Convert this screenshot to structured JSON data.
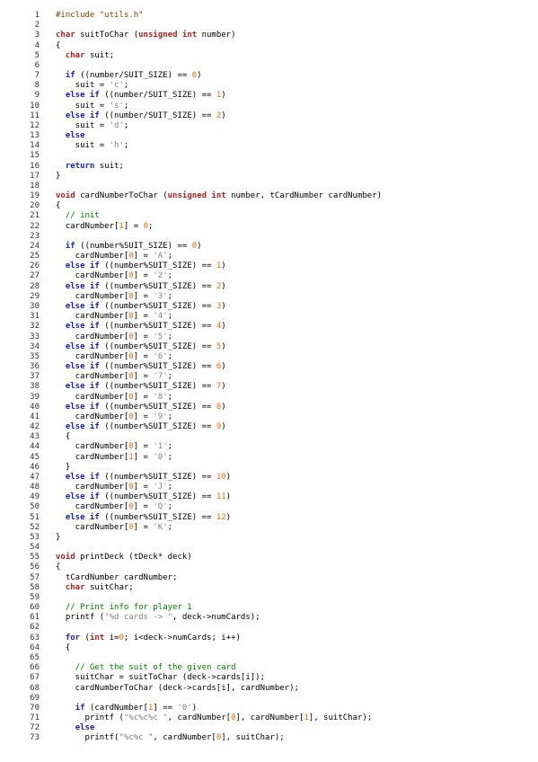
{
  "colors": {
    "keyword": "#1c1cd0",
    "type": "#b02020",
    "number": "#ff6600",
    "string": "#808080",
    "comment": "#008000",
    "preprocessor": "#804000"
  },
  "lines": [
    {
      "n": "1",
      "tokens": [
        [
          "pp",
          "#include \"utils.h\""
        ]
      ]
    },
    {
      "n": "2",
      "tokens": []
    },
    {
      "n": "3",
      "tokens": [
        [
          "ty",
          "char"
        ],
        [
          "",
          " suitToChar ("
        ],
        [
          "ty",
          "unsigned int"
        ],
        [
          "",
          " number)"
        ]
      ]
    },
    {
      "n": "4",
      "tokens": [
        [
          "",
          "{"
        ]
      ]
    },
    {
      "n": "5",
      "tokens": [
        [
          "",
          "  "
        ],
        [
          "ty",
          "char"
        ],
        [
          "",
          " suit;"
        ]
      ]
    },
    {
      "n": "6",
      "tokens": []
    },
    {
      "n": "7",
      "tokens": [
        [
          "",
          "  "
        ],
        [
          "kw",
          "if"
        ],
        [
          "",
          " ((number/SUIT_SIZE) == "
        ],
        [
          "num",
          "0"
        ],
        [
          "",
          ")"
        ]
      ]
    },
    {
      "n": "8",
      "tokens": [
        [
          "",
          "    suit = "
        ],
        [
          "str",
          "'c'"
        ],
        [
          "",
          ";"
        ]
      ]
    },
    {
      "n": "9",
      "tokens": [
        [
          "",
          "  "
        ],
        [
          "kw",
          "else if"
        ],
        [
          "",
          " ((number/SUIT_SIZE) == "
        ],
        [
          "num",
          "1"
        ],
        [
          "",
          ")"
        ]
      ]
    },
    {
      "n": "10",
      "tokens": [
        [
          "",
          "    suit = "
        ],
        [
          "str",
          "'s'"
        ],
        [
          "",
          ";"
        ]
      ]
    },
    {
      "n": "11",
      "tokens": [
        [
          "",
          "  "
        ],
        [
          "kw",
          "else if"
        ],
        [
          "",
          " ((number/SUIT_SIZE) == "
        ],
        [
          "num",
          "2"
        ],
        [
          "",
          ")"
        ]
      ]
    },
    {
      "n": "12",
      "tokens": [
        [
          "",
          "    suit = "
        ],
        [
          "str",
          "'d'"
        ],
        [
          "",
          ";"
        ]
      ]
    },
    {
      "n": "13",
      "tokens": [
        [
          "",
          "  "
        ],
        [
          "kw",
          "else"
        ]
      ]
    },
    {
      "n": "14",
      "tokens": [
        [
          "",
          "    suit = "
        ],
        [
          "str",
          "'h'"
        ],
        [
          "",
          ";"
        ]
      ]
    },
    {
      "n": "15",
      "tokens": []
    },
    {
      "n": "16",
      "tokens": [
        [
          "",
          "  "
        ],
        [
          "kw",
          "return"
        ],
        [
          "",
          " suit;"
        ]
      ]
    },
    {
      "n": "17",
      "tokens": [
        [
          "",
          "}"
        ]
      ]
    },
    {
      "n": "18",
      "tokens": []
    },
    {
      "n": "19",
      "tokens": [
        [
          "ty",
          "void"
        ],
        [
          "",
          " cardNumberToChar ("
        ],
        [
          "ty",
          "unsigned int"
        ],
        [
          "",
          " number, tCardNumber cardNumber)"
        ]
      ]
    },
    {
      "n": "20",
      "tokens": [
        [
          "",
          "{"
        ]
      ]
    },
    {
      "n": "21",
      "tokens": [
        [
          "",
          "  "
        ],
        [
          "cm",
          "// init"
        ]
      ]
    },
    {
      "n": "22",
      "tokens": [
        [
          "",
          "  cardNumber["
        ],
        [
          "num",
          "1"
        ],
        [
          "",
          "] = "
        ],
        [
          "num",
          "0"
        ],
        [
          "",
          ";"
        ]
      ]
    },
    {
      "n": "23",
      "tokens": []
    },
    {
      "n": "24",
      "tokens": [
        [
          "",
          "  "
        ],
        [
          "kw",
          "if"
        ],
        [
          "",
          " ((number%SUIT_SIZE) == "
        ],
        [
          "num",
          "0"
        ],
        [
          "",
          ")"
        ]
      ]
    },
    {
      "n": "25",
      "tokens": [
        [
          "",
          "    cardNumber["
        ],
        [
          "num",
          "0"
        ],
        [
          "",
          "] = "
        ],
        [
          "str",
          "'A'"
        ],
        [
          "",
          ";"
        ]
      ]
    },
    {
      "n": "26",
      "tokens": [
        [
          "",
          "  "
        ],
        [
          "kw",
          "else if"
        ],
        [
          "",
          " ((number%SUIT_SIZE) == "
        ],
        [
          "num",
          "1"
        ],
        [
          "",
          ")"
        ]
      ]
    },
    {
      "n": "27",
      "tokens": [
        [
          "",
          "    cardNumber["
        ],
        [
          "num",
          "0"
        ],
        [
          "",
          "] = "
        ],
        [
          "str",
          "'2'"
        ],
        [
          "",
          ";"
        ]
      ]
    },
    {
      "n": "28",
      "tokens": [
        [
          "",
          "  "
        ],
        [
          "kw",
          "else if"
        ],
        [
          "",
          " ((number%SUIT_SIZE) == "
        ],
        [
          "num",
          "2"
        ],
        [
          "",
          ")"
        ]
      ]
    },
    {
      "n": "29",
      "tokens": [
        [
          "",
          "    cardNumber["
        ],
        [
          "num",
          "0"
        ],
        [
          "",
          "] = "
        ],
        [
          "str",
          "'3'"
        ],
        [
          "",
          ";"
        ]
      ]
    },
    {
      "n": "30",
      "tokens": [
        [
          "",
          "  "
        ],
        [
          "kw",
          "else if"
        ],
        [
          "",
          " ((number%SUIT_SIZE) == "
        ],
        [
          "num",
          "3"
        ],
        [
          "",
          ")"
        ]
      ]
    },
    {
      "n": "31",
      "tokens": [
        [
          "",
          "    cardNumber["
        ],
        [
          "num",
          "0"
        ],
        [
          "",
          "] = "
        ],
        [
          "str",
          "'4'"
        ],
        [
          "",
          ";"
        ]
      ]
    },
    {
      "n": "32",
      "tokens": [
        [
          "",
          "  "
        ],
        [
          "kw",
          "else if"
        ],
        [
          "",
          " ((number%SUIT_SIZE) == "
        ],
        [
          "num",
          "4"
        ],
        [
          "",
          ")"
        ]
      ]
    },
    {
      "n": "33",
      "tokens": [
        [
          "",
          "    cardNumber["
        ],
        [
          "num",
          "0"
        ],
        [
          "",
          "] = "
        ],
        [
          "str",
          "'5'"
        ],
        [
          "",
          ";"
        ]
      ]
    },
    {
      "n": "34",
      "tokens": [
        [
          "",
          "  "
        ],
        [
          "kw",
          "else if"
        ],
        [
          "",
          " ((number%SUIT_SIZE) == "
        ],
        [
          "num",
          "5"
        ],
        [
          "",
          ")"
        ]
      ]
    },
    {
      "n": "35",
      "tokens": [
        [
          "",
          "    cardNumber["
        ],
        [
          "num",
          "0"
        ],
        [
          "",
          "] = "
        ],
        [
          "str",
          "'6'"
        ],
        [
          "",
          ";"
        ]
      ]
    },
    {
      "n": "36",
      "tokens": [
        [
          "",
          "  "
        ],
        [
          "kw",
          "else if"
        ],
        [
          "",
          " ((number%SUIT_SIZE) == "
        ],
        [
          "num",
          "6"
        ],
        [
          "",
          ")"
        ]
      ]
    },
    {
      "n": "37",
      "tokens": [
        [
          "",
          "    cardNumber["
        ],
        [
          "num",
          "0"
        ],
        [
          "",
          "] = "
        ],
        [
          "str",
          "'7'"
        ],
        [
          "",
          ";"
        ]
      ]
    },
    {
      "n": "38",
      "tokens": [
        [
          "",
          "  "
        ],
        [
          "kw",
          "else if"
        ],
        [
          "",
          " ((number%SUIT_SIZE) == "
        ],
        [
          "num",
          "7"
        ],
        [
          "",
          ")"
        ]
      ]
    },
    {
      "n": "39",
      "tokens": [
        [
          "",
          "    cardNumber["
        ],
        [
          "num",
          "0"
        ],
        [
          "",
          "] = "
        ],
        [
          "str",
          "'8'"
        ],
        [
          "",
          ";"
        ]
      ]
    },
    {
      "n": "40",
      "tokens": [
        [
          "",
          "  "
        ],
        [
          "kw",
          "else if"
        ],
        [
          "",
          " ((number%SUIT_SIZE) == "
        ],
        [
          "num",
          "8"
        ],
        [
          "",
          ")"
        ]
      ]
    },
    {
      "n": "41",
      "tokens": [
        [
          "",
          "    cardNumber["
        ],
        [
          "num",
          "0"
        ],
        [
          "",
          "] = "
        ],
        [
          "str",
          "'9'"
        ],
        [
          "",
          ";"
        ]
      ]
    },
    {
      "n": "42",
      "tokens": [
        [
          "",
          "  "
        ],
        [
          "kw",
          "else if"
        ],
        [
          "",
          " ((number%SUIT_SIZE) == "
        ],
        [
          "num",
          "9"
        ],
        [
          "",
          ")"
        ]
      ]
    },
    {
      "n": "43",
      "tokens": [
        [
          "",
          "  {"
        ]
      ]
    },
    {
      "n": "44",
      "tokens": [
        [
          "",
          "    cardNumber["
        ],
        [
          "num",
          "0"
        ],
        [
          "",
          "] = "
        ],
        [
          "str",
          "'1'"
        ],
        [
          "",
          ";"
        ]
      ]
    },
    {
      "n": "45",
      "tokens": [
        [
          "",
          "    cardNumber["
        ],
        [
          "num",
          "1"
        ],
        [
          "",
          "] = "
        ],
        [
          "str",
          "'0'"
        ],
        [
          "",
          ";"
        ]
      ]
    },
    {
      "n": "46",
      "tokens": [
        [
          "",
          "  }"
        ]
      ]
    },
    {
      "n": "47",
      "tokens": [
        [
          "",
          "  "
        ],
        [
          "kw",
          "else if"
        ],
        [
          "",
          " ((number%SUIT_SIZE) == "
        ],
        [
          "num",
          "10"
        ],
        [
          "",
          ")"
        ]
      ]
    },
    {
      "n": "48",
      "tokens": [
        [
          "",
          "    cardNumber["
        ],
        [
          "num",
          "0"
        ],
        [
          "",
          "] = "
        ],
        [
          "str",
          "'J'"
        ],
        [
          "",
          ";"
        ]
      ]
    },
    {
      "n": "49",
      "tokens": [
        [
          "",
          "  "
        ],
        [
          "kw",
          "else if"
        ],
        [
          "",
          " ((number%SUIT_SIZE) == "
        ],
        [
          "num",
          "11"
        ],
        [
          "",
          ")"
        ]
      ]
    },
    {
      "n": "50",
      "tokens": [
        [
          "",
          "    cardNumber["
        ],
        [
          "num",
          "0"
        ],
        [
          "",
          "] = "
        ],
        [
          "str",
          "'Q'"
        ],
        [
          "",
          ";"
        ]
      ]
    },
    {
      "n": "51",
      "tokens": [
        [
          "",
          "  "
        ],
        [
          "kw",
          "else if"
        ],
        [
          "",
          " ((number%SUIT_SIZE) == "
        ],
        [
          "num",
          "12"
        ],
        [
          "",
          ")"
        ]
      ]
    },
    {
      "n": "52",
      "tokens": [
        [
          "",
          "    cardNumber["
        ],
        [
          "num",
          "0"
        ],
        [
          "",
          "] = "
        ],
        [
          "str",
          "'K'"
        ],
        [
          "",
          ";"
        ]
      ]
    },
    {
      "n": "53",
      "tokens": [
        [
          "",
          "}"
        ]
      ]
    },
    {
      "n": "54",
      "tokens": []
    },
    {
      "n": "55",
      "tokens": [
        [
          "ty",
          "void"
        ],
        [
          "",
          " printDeck (tDeck* deck)"
        ]
      ]
    },
    {
      "n": "56",
      "tokens": [
        [
          "",
          "{"
        ]
      ]
    },
    {
      "n": "57",
      "tokens": [
        [
          "",
          "  tCardNumber cardNumber;"
        ]
      ]
    },
    {
      "n": "58",
      "tokens": [
        [
          "",
          "  "
        ],
        [
          "ty",
          "char"
        ],
        [
          "",
          " suitChar;"
        ]
      ]
    },
    {
      "n": "59",
      "tokens": []
    },
    {
      "n": "60",
      "tokens": [
        [
          "",
          "  "
        ],
        [
          "cm",
          "// Print info for player 1"
        ]
      ]
    },
    {
      "n": "61",
      "tokens": [
        [
          "",
          "  printf ("
        ],
        [
          "str",
          "\"%d cards -> \""
        ],
        [
          "",
          ", deck->numCards);"
        ]
      ]
    },
    {
      "n": "62",
      "tokens": []
    },
    {
      "n": "63",
      "tokens": [
        [
          "",
          "  "
        ],
        [
          "kw",
          "for"
        ],
        [
          "",
          " ("
        ],
        [
          "ty",
          "int"
        ],
        [
          "",
          " i="
        ],
        [
          "num",
          "0"
        ],
        [
          "",
          "; i<deck->numCards; i++)"
        ]
      ]
    },
    {
      "n": "64",
      "tokens": [
        [
          "",
          "  {"
        ]
      ]
    },
    {
      "n": "65",
      "tokens": []
    },
    {
      "n": "66",
      "tokens": [
        [
          "",
          "    "
        ],
        [
          "cm",
          "// Get the suit of the given card"
        ]
      ]
    },
    {
      "n": "67",
      "tokens": [
        [
          "",
          "    suitChar = suitToChar (deck->cards[i]);"
        ]
      ]
    },
    {
      "n": "68",
      "tokens": [
        [
          "",
          "    cardNumberToChar (deck->cards[i], cardNumber);"
        ]
      ]
    },
    {
      "n": "69",
      "tokens": []
    },
    {
      "n": "70",
      "tokens": [
        [
          "",
          "    "
        ],
        [
          "kw",
          "if"
        ],
        [
          "",
          " (cardNumber["
        ],
        [
          "num",
          "1"
        ],
        [
          "",
          "] == "
        ],
        [
          "str",
          "'0'"
        ],
        [
          "",
          ")"
        ]
      ]
    },
    {
      "n": "71",
      "tokens": [
        [
          "",
          "      printf ("
        ],
        [
          "str",
          "\"%c%c%c \""
        ],
        [
          "",
          ", cardNumber["
        ],
        [
          "num",
          "0"
        ],
        [
          "",
          "], cardNumber["
        ],
        [
          "num",
          "1"
        ],
        [
          "",
          "], suitChar);"
        ]
      ]
    },
    {
      "n": "72",
      "tokens": [
        [
          "",
          "    "
        ],
        [
          "kw",
          "else"
        ]
      ]
    },
    {
      "n": "73",
      "tokens": [
        [
          "",
          "      printf("
        ],
        [
          "str",
          "\"%c%c \""
        ],
        [
          "",
          ", cardNumber["
        ],
        [
          "num",
          "0"
        ],
        [
          "",
          "], suitChar);"
        ]
      ]
    }
  ]
}
